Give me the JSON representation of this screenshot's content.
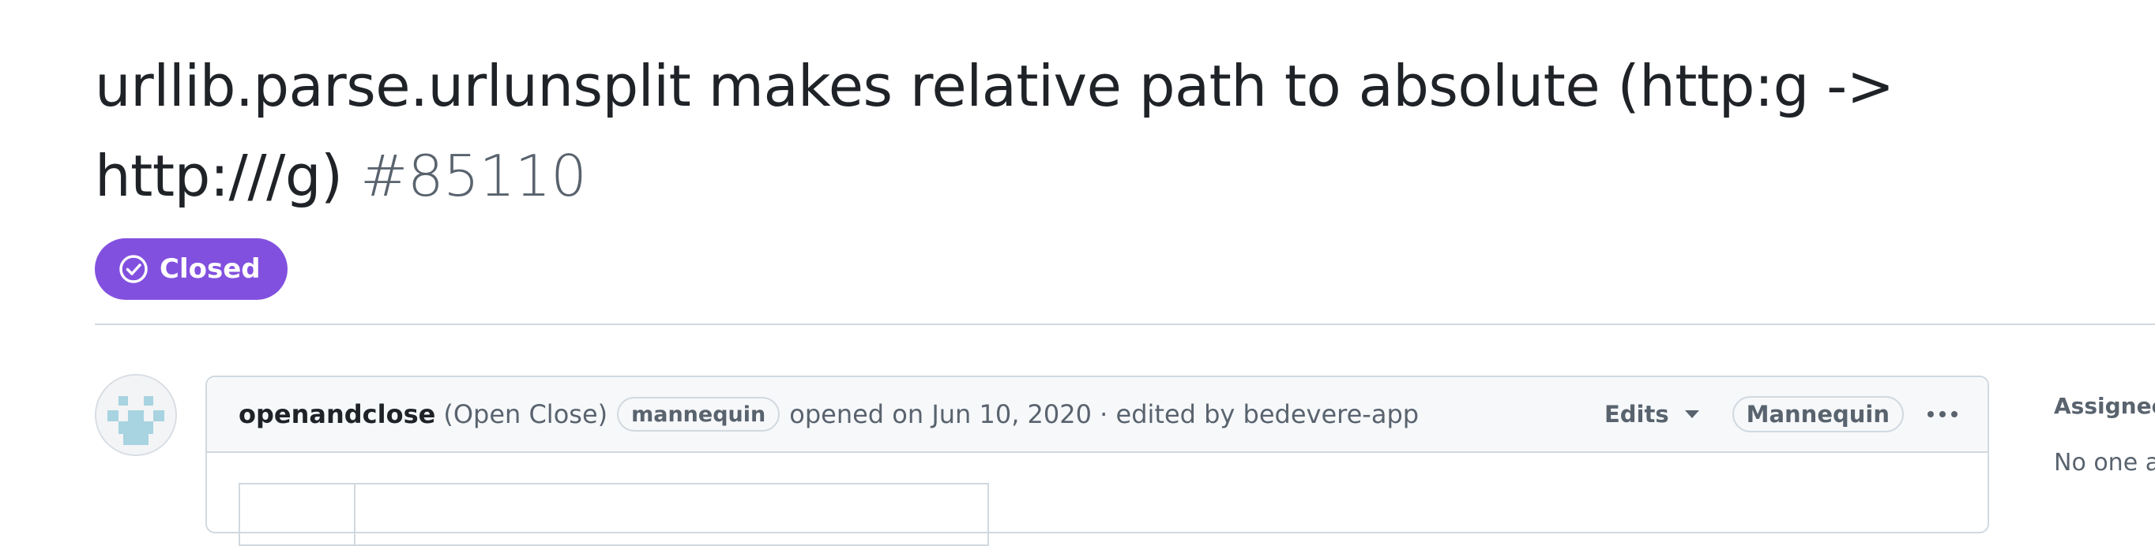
{
  "issue": {
    "title": "urllib.parse.urlunsplit makes relative path to absolute (http:g -> http:///g)",
    "number": "#85110",
    "state_label": "Closed",
    "state_color": "#8250df"
  },
  "comment": {
    "author": "openandclose",
    "author_full_name": "(Open Close)",
    "author_badge": "mannequin",
    "meta_text": "opened on Jun 10, 2020 · edited by bedevere-app",
    "edits_label": "Edits",
    "role_badge": "Mannequin",
    "avatar_icon": "identicon-avatar",
    "menu_icon": "kebab-horizontal-icon"
  },
  "sidebar": {
    "assignees_heading": "Assignees",
    "assignees_value": "No one assigned"
  },
  "icons": {
    "state": "check-circle-icon",
    "edits_caret": "triangle-down-icon"
  }
}
